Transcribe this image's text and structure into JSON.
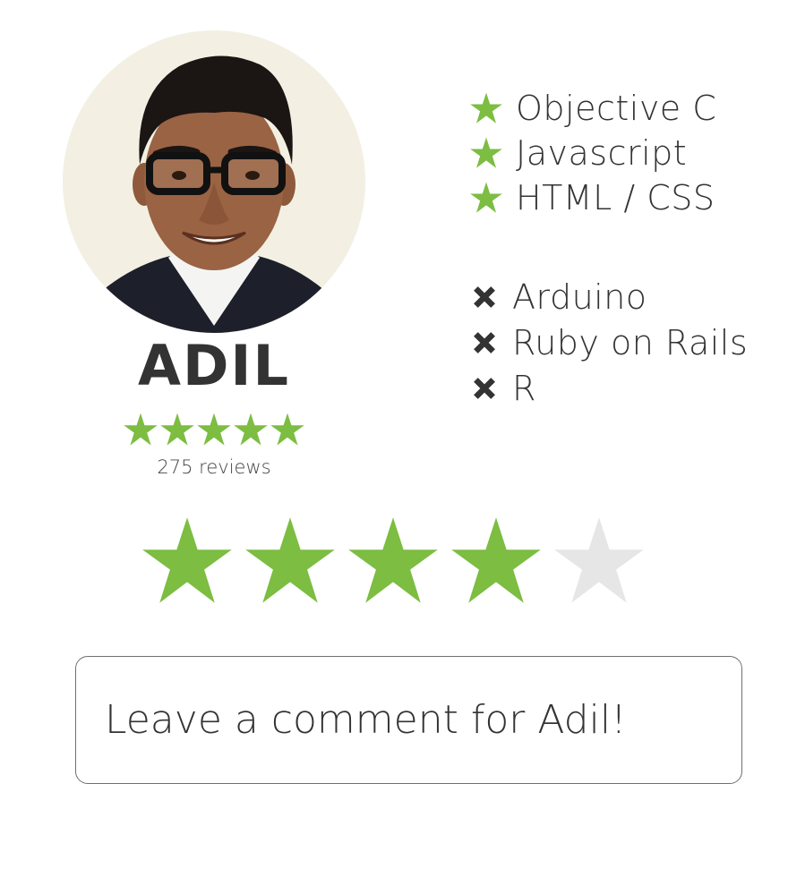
{
  "profile": {
    "name": "ADIL",
    "reviews_text": "275 reviews",
    "average_rating": 5,
    "rating_max": 5
  },
  "skills": {
    "known": [
      {
        "label": "Objective C",
        "icon": "star-icon"
      },
      {
        "label": "Javascript",
        "icon": "star-icon"
      },
      {
        "label": "HTML / CSS",
        "icon": "star-icon"
      }
    ],
    "not_known": [
      {
        "label": "Arduino",
        "icon": "x-icon"
      },
      {
        "label": "Ruby on Rails",
        "icon": "x-icon"
      },
      {
        "label": "R",
        "icon": "x-icon"
      }
    ]
  },
  "user_rating": {
    "value": 4,
    "max": 5
  },
  "comment": {
    "placeholder": "Leave a comment for Adil!",
    "value": ""
  },
  "colors": {
    "star_filled": "#7cbd42",
    "star_empty": "#e6e6e6",
    "text": "#333333",
    "border": "#6f6f6f"
  }
}
